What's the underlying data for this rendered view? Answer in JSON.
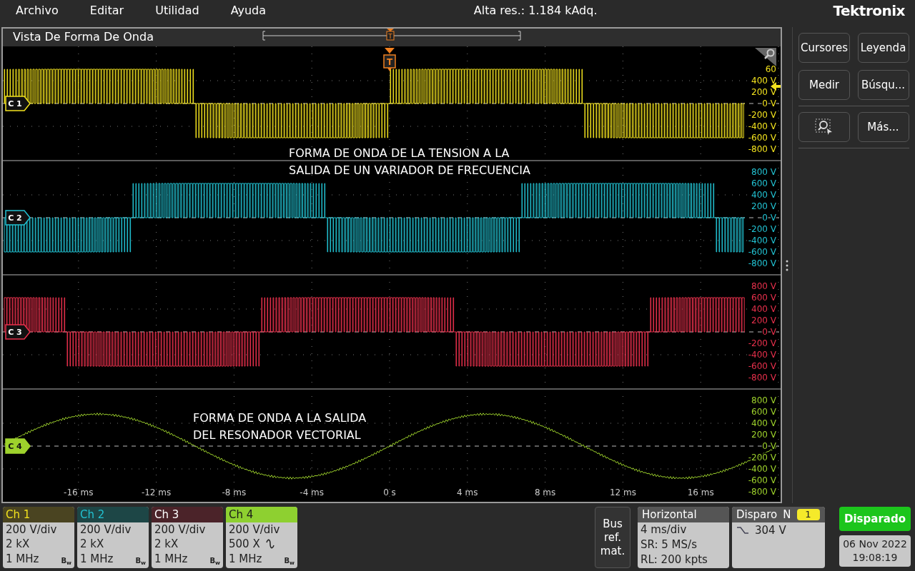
{
  "menu": [
    "Archivo",
    "Editar",
    "Utilidad",
    "Ayuda"
  ],
  "acquisition": "Alta res.: 1.184 kAdq.",
  "brand": "Tektronix",
  "waveform_view": {
    "title": "Vista De Forma De Onda",
    "overview_marker": "T",
    "trigger_marker": "T",
    "channels": [
      {
        "label": "C 1",
        "color": "#f2e21e",
        "kind": "pwm",
        "axis_labels": [
          "60",
          "400 V",
          "200 V",
          "0 V",
          "-200 V",
          "-400 V",
          "-600 V",
          "-800 V"
        ],
        "annotation": "FORMA DE ONDA DE LA TENSION A LA\nSALIDA DE UN VARIADOR DE FRECUENCIA"
      },
      {
        "label": "C 2",
        "color": "#22c2d2",
        "kind": "pwm",
        "axis_labels": [
          "800 V",
          "600 V",
          "400 V",
          "200 V",
          "0 V",
          "-200 V",
          "-400 V",
          "-600 V",
          "-800 V"
        ]
      },
      {
        "label": "C 3",
        "color": "#e8304c",
        "kind": "pwm",
        "axis_labels": [
          "800 V",
          "600 V",
          "400 V",
          "200 V",
          "0 V",
          "-200 V",
          "-400 V",
          "-600 V",
          "-800 V"
        ]
      },
      {
        "label": "C 4",
        "color": "#9ed22c",
        "kind": "sine",
        "axis_labels": [
          "800 V",
          "600 V",
          "400 V",
          "200 V",
          "0 V",
          "-200 V",
          "-400 V",
          "-600 V",
          "-800 V"
        ],
        "annotation": "FORMA DE ONDA A LA SALIDA\nDEL RESONADOR VECTORIAL"
      }
    ],
    "time_labels": [
      "-16 ms",
      "-12 ms",
      "-8 ms",
      "-4 ms",
      "0 s",
      "4 ms",
      "8 ms",
      "12 ms",
      "16 ms"
    ]
  },
  "side_buttons": [
    {
      "kind": "text",
      "label": "Cursores"
    },
    {
      "kind": "text",
      "label": "Leyenda"
    },
    {
      "kind": "text",
      "label": "Medir"
    },
    {
      "kind": "text",
      "label": "Búsqu..."
    },
    {
      "kind": "zoom"
    },
    {
      "kind": "text",
      "label": "Más..."
    }
  ],
  "channel_badges": [
    {
      "name": "Ch 1",
      "color": "#4a4421",
      "scale": "200 V/div",
      "probe": "2 kX",
      "bandwidth": "1 MHz",
      "bw_mark": "B$_{w}$",
      "ac_coupling": false
    },
    {
      "name": "Ch 2",
      "color": "#1d4646",
      "scale": "200 V/div",
      "probe": "2 kX",
      "bandwidth": "1 MHz",
      "bw_mark": "B$_{w}$",
      "ac_coupling": false
    },
    {
      "name": "Ch 3",
      "color": "#4b2329",
      "scale": "200 V/div",
      "probe": "2 kX",
      "bandwidth": "1 MHz",
      "bw_mark": "B$_{w}$",
      "ac_coupling": false
    },
    {
      "name": "Ch 4",
      "color": "#8ed030",
      "scale": "200 V/div",
      "probe": "500 X",
      "bandwidth": "1 MHz",
      "bw_mark": "B$_{w}$",
      "ac_coupling": true
    }
  ],
  "bus_button": "Bus\nref.\nmat.",
  "horizontal": {
    "title": "Horizontal",
    "lines": [
      "4 ms/div",
      "SR: 5 MS/s",
      "RL: 200 kpts"
    ]
  },
  "trigger": {
    "title": "Disparo",
    "mode": "N",
    "source": "1",
    "level": "304 V"
  },
  "status": "Disparado",
  "date": "06 Nov 2022",
  "time": "19:08:19"
}
